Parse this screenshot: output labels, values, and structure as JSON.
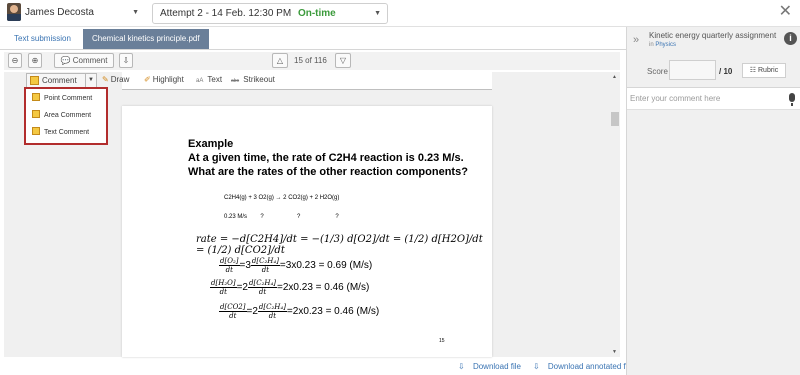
{
  "topbar": {
    "student_name": "James Decosta",
    "attempt_label": "Attempt 2 - 14 Feb. 12:30 PM",
    "attempt_status": "On-time"
  },
  "tabs": [
    {
      "label": "Text submission"
    },
    {
      "label": "Chemical kinetics principle.pdf"
    }
  ],
  "toolbar": {
    "comment_label": "Comment",
    "page_count": "15 of 116"
  },
  "annotation_toolbar": {
    "comment_label": "Comment",
    "draw_label": "Draw",
    "highlight_label": "Highlight",
    "text_label": "Text",
    "strikeout_label": "Strikeout",
    "text_prefix": "aA",
    "strike_prefix": "abc"
  },
  "comment_menu": [
    {
      "label": "Point Comment"
    },
    {
      "label": "Area Comment"
    },
    {
      "label": "Text Comment"
    }
  ],
  "document": {
    "title": "Example",
    "question": "At a given time, the rate of C2H4 reaction is 0.23 M/s.  What are the rates of the other reaction components?",
    "equation": "C2H4(g) + 3 O2(g) → 2 CO2(g) + 2 H2O(g)",
    "values": [
      "0.23 M/s",
      "?",
      "?",
      "?"
    ],
    "rate_label": "rate",
    "rate_expression": "= −d[C2H4]/dt = −(1/3) d[O2]/dt = (1/2) d[H2O]/dt = (1/2) d[CO2]/dt",
    "line1_result": "=3x0.23 = 0.69 (M/s)",
    "line2_result": "=2x0.23 = 0.46 (M/s)",
    "line3_result": "=2x0.23 = 0.46 (M/s)",
    "page_number": "15"
  },
  "footer": {
    "download_file": "Download file",
    "download_annotated": "Download annotated file"
  },
  "right_panel": {
    "assignment_title": "Kinetic energy quarterly assignment",
    "assignment_in": "in",
    "assignment_course": "Physics",
    "score_label": "Score",
    "score_max": "/ 10",
    "rubric_label": "Rubric",
    "comment_placeholder": "Enter your comment here"
  },
  "colors": {
    "accent": "#3a74b3",
    "active_tab": "#6a7f99",
    "status_ok": "#3b9a3b",
    "menu_highlight_border": "#b22d2d"
  }
}
